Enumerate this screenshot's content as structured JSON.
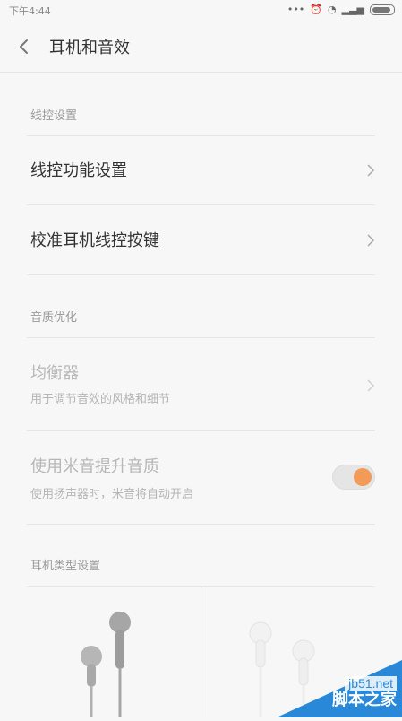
{
  "status_bar": {
    "time": "下午4:44",
    "icons": [
      "signal-dots-icon",
      "alarm-icon",
      "wifi-icon",
      "cell-signal-icon",
      "battery-icon"
    ]
  },
  "header": {
    "title": "耳机和音效"
  },
  "sections": {
    "wire_control": {
      "label": "线控设置",
      "items": [
        {
          "title": "线控功能设置"
        },
        {
          "title": "校准耳机线控按键"
        }
      ]
    },
    "sound_quality": {
      "label": "音质优化",
      "equalizer": {
        "title": "均衡器",
        "subtitle": "用于调节音效的风格和细节"
      },
      "mi_sound": {
        "title": "使用米音提升音质",
        "subtitle": "使用扬声器时，米音将自动开启",
        "enabled": true
      }
    },
    "headphone_type": {
      "label": "耳机类型设置"
    }
  },
  "watermark": {
    "url": "jb51.net",
    "name": "脚本之家"
  },
  "colors": {
    "accent": "#f29a57",
    "watermark_blue": "#2a88d8"
  }
}
